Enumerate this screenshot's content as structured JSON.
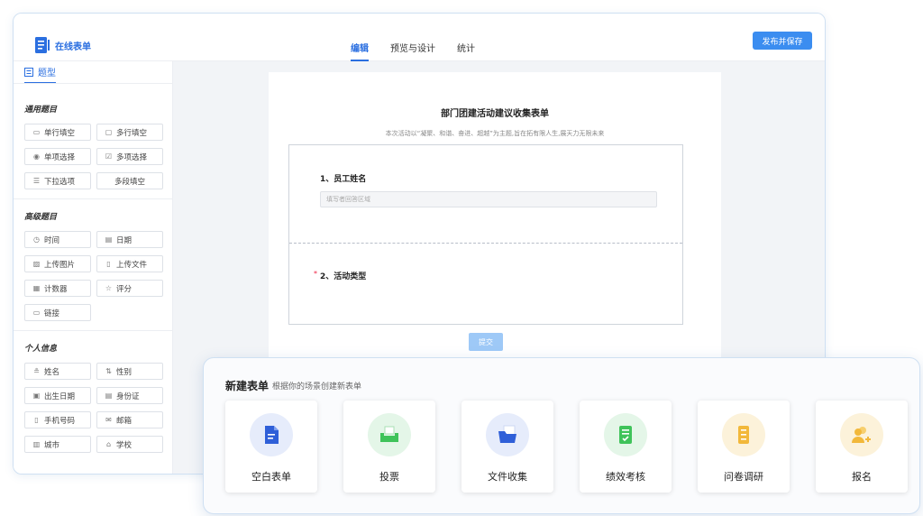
{
  "app": {
    "name": "在线表单"
  },
  "tabs": [
    {
      "label": "编辑",
      "active": true
    },
    {
      "label": "预览与设计",
      "active": false
    },
    {
      "label": "统计",
      "active": false
    }
  ],
  "publish_label": "发布并保存",
  "sidebar": {
    "tab_label": "题型",
    "groups": [
      {
        "title": "通用题目",
        "items": [
          {
            "label": "单行填空",
            "icon": "input-icon"
          },
          {
            "label": "多行填空",
            "icon": "textarea-icon"
          },
          {
            "label": "单项选择",
            "icon": "radio-icon"
          },
          {
            "label": "多项选择",
            "icon": "checkbox-icon"
          },
          {
            "label": "下拉选项",
            "icon": "list-icon"
          },
          {
            "label": "多段填空",
            "icon": ""
          }
        ]
      },
      {
        "title": "高级题目",
        "items": [
          {
            "label": "时间",
            "icon": "clock-icon"
          },
          {
            "label": "日期",
            "icon": "calendar-icon"
          },
          {
            "label": "上传图片",
            "icon": "image-icon"
          },
          {
            "label": "上传文件",
            "icon": "file-icon"
          },
          {
            "label": "计数器",
            "icon": "counter-icon"
          },
          {
            "label": "评分",
            "icon": "star-icon"
          },
          {
            "label": "链接",
            "icon": "link-icon"
          }
        ]
      },
      {
        "title": "个人信息",
        "items": [
          {
            "label": "姓名",
            "icon": "person-icon"
          },
          {
            "label": "性别",
            "icon": "gender-icon"
          },
          {
            "label": "出生日期",
            "icon": "birthday-icon"
          },
          {
            "label": "身份证",
            "icon": "id-card-icon"
          },
          {
            "label": "手机号码",
            "icon": "phone-icon"
          },
          {
            "label": "邮箱",
            "icon": "mail-icon"
          },
          {
            "label": "城市",
            "icon": "city-icon"
          },
          {
            "label": "学校",
            "icon": "school-icon"
          }
        ]
      }
    ]
  },
  "form": {
    "title": "部门团建活动建议收集表单",
    "description": "本次活动以“凝聚、和谐、奋进、超越”为主题,旨在拓有限人生,展天力无限未来",
    "questions": [
      {
        "label": "1、员工姓名",
        "placeholder": "填写者回答区域"
      },
      {
        "label": "2、活动类型",
        "required_mark": "*"
      }
    ],
    "submit_label": "提交"
  },
  "new_form": {
    "title": "新建表单",
    "subtitle": "根据你的场景创建新表单",
    "templates": [
      {
        "label": "空白表单",
        "icon": "blank-form-icon",
        "color": "#2f5fd8",
        "bg": "#e6ecfb"
      },
      {
        "label": "投票",
        "icon": "vote-box-icon",
        "color": "#3fc35a",
        "bg": "#e4f6e8"
      },
      {
        "label": "文件收集",
        "icon": "folder-icon",
        "color": "#2f5fd8",
        "bg": "#e6ecfb"
      },
      {
        "label": "绩效考核",
        "icon": "clipboard-check-icon",
        "color": "#3fc35a",
        "bg": "#e4f6e8"
      },
      {
        "label": "问卷调研",
        "icon": "survey-icon",
        "color": "#f2b83a",
        "bg": "#fcf2da"
      },
      {
        "label": "报名",
        "icon": "signup-people-icon",
        "color": "#f2b83a",
        "bg": "#fcf2da"
      }
    ]
  }
}
